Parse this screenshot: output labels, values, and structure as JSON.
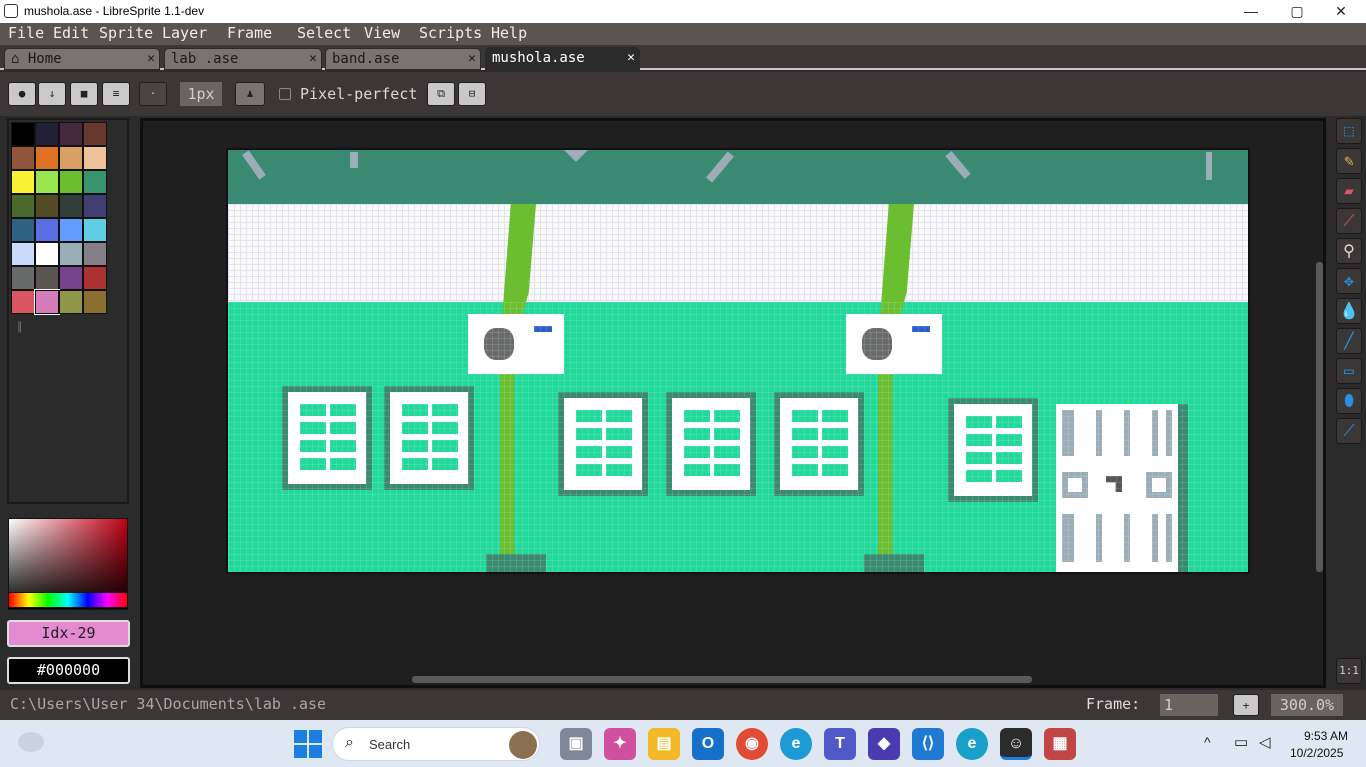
{
  "window": {
    "title": "mushola.ase - LibreSprite 1.1-dev",
    "minimize": "—",
    "maximize": "▢",
    "close": "✕"
  },
  "menu": [
    "File",
    "Edit",
    "Sprite",
    "Layer",
    "Frame",
    "Select",
    "View",
    "Scripts",
    "Help"
  ],
  "tabs": [
    {
      "label": "Home",
      "close": "✕"
    },
    {
      "label": "lab .ase",
      "close": "✕"
    },
    {
      "label": "band.ase",
      "close": "✕"
    },
    {
      "label": "mushola.ase",
      "close": "✕",
      "active": true
    }
  ],
  "context": {
    "brush_size": "1px",
    "pixel_perfect_label": "Pixel-perfect",
    "pixel_perfect_checked": false
  },
  "palette": {
    "colors": [
      "#000000",
      "#222034",
      "#45283c",
      "#663931",
      "#8f563b",
      "#df7126",
      "#d9a066",
      "#eec39a",
      "#fbf236",
      "#99e550",
      "#6abe30",
      "#37946e",
      "#4b692f",
      "#524b24",
      "#323c39",
      "#3f3f74",
      "#306082",
      "#5b6ee1",
      "#639bff",
      "#5fcde4",
      "#cbdbfc",
      "#ffffff",
      "#9badb7",
      "#847e87",
      "#696a6a",
      "#595652",
      "#76428a",
      "#ac3232",
      "#d95763",
      "#d77bba",
      "#8f974a",
      "#8a6f30"
    ],
    "selected_index": 29
  },
  "color": {
    "index_label": "Idx-29",
    "hex_label": "#000000"
  },
  "status": {
    "path": "C:\\Users\\User 34\\Documents\\lab .ase",
    "frame_label": "Frame:",
    "frame_value": "1",
    "add_frame": "+",
    "zoom": "300.0%"
  },
  "zoom_reset": "1:1",
  "taskbar": {
    "search_placeholder": "Search",
    "time": "9:53 AM",
    "date": "10/2/2025"
  },
  "colors": {
    "accent": "#2b8fe0",
    "roof": "#3a8a72",
    "wall": "#22d89a",
    "pillar": "#6abe30"
  }
}
